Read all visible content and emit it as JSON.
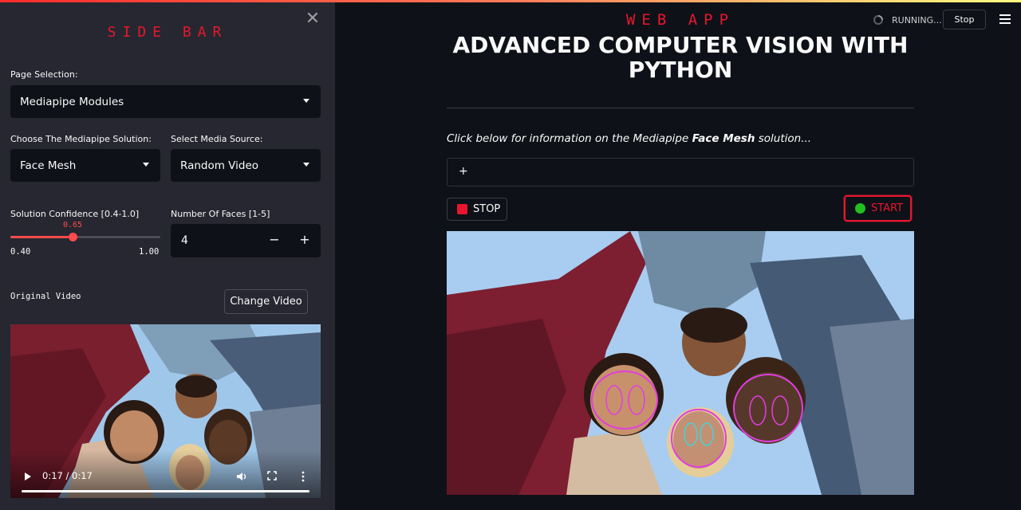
{
  "sidebar": {
    "title": "SIDE BAR",
    "page_selection": {
      "label": "Page Selection:",
      "value": "Mediapipe Modules"
    },
    "solution": {
      "label": "Choose The Mediapipe Solution:",
      "value": "Face Mesh"
    },
    "media_source": {
      "label": "Select Media Source:",
      "value": "Random Video"
    },
    "confidence": {
      "label": "Solution Confidence [0.4-1.0]",
      "value": "0.65",
      "min": "0.40",
      "max": "1.00",
      "fraction": 0.4167
    },
    "faces": {
      "label": "Number Of Faces [1-5]",
      "value": "4"
    },
    "original_video_label": "Original Video",
    "change_video_label": "Change Video",
    "video": {
      "time": "0:17 / 0:17",
      "progress": 1.0
    }
  },
  "main": {
    "web_app_label": "WEB APP",
    "title_line1": "ADVANCED COMPUTER VISION WITH",
    "title_line2": "PYTHON",
    "info_prefix": "Click below for information on the Mediapipe ",
    "info_bold": "Face Mesh",
    "info_suffix": " solution...",
    "expander_symbol": "+",
    "stop_label": "STOP",
    "start_label": "START"
  },
  "header": {
    "status": "RUNNING...",
    "stop_label": "Stop"
  },
  "colors": {
    "accent": "#e8162e",
    "slider": "#ff4b4b",
    "start_dot": "#21c021",
    "sidebar_bg": "#262730",
    "main_bg": "#0e1117"
  }
}
